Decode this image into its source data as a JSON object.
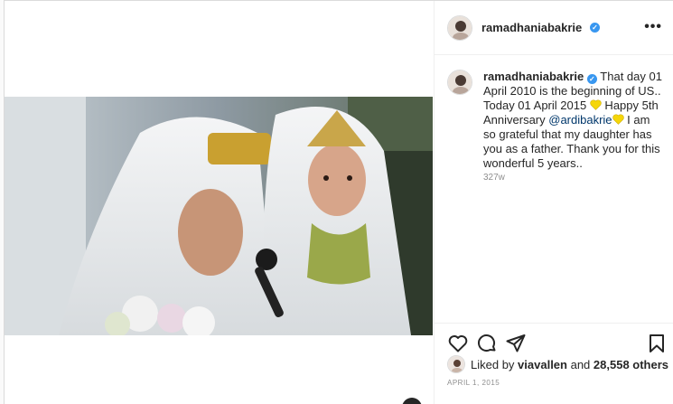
{
  "post": {
    "username": "ramadhaniabakrie",
    "verified": true,
    "more_icon": "more-horizontal-icon"
  },
  "caption": {
    "username": "ramadhaniabakrie",
    "text_before_mention": "That day 01 April 2010 is the beginning of US.. Today 01 April 2015 ",
    "heart_1": "yellow-heart-icon",
    "text_between": " Happy 5th Anniversary ",
    "mention": "@ardibakrie",
    "heart_2": "yellow-heart-icon",
    "text_after": " I am so grateful that my daughter has you as a father. Thank you for this wonderful 5 years..",
    "age": "327w"
  },
  "actions": {
    "like_icon": "heart-outline-icon",
    "comment_icon": "comment-icon",
    "share_icon": "paper-plane-icon",
    "save_icon": "bookmark-icon"
  },
  "likes": {
    "prefix": "Liked by ",
    "first_liker": "viavallen",
    "and": " and ",
    "others": "28,558 others"
  },
  "date": "APRIL 1, 2015",
  "colors": {
    "accent_blue": "#3897f0",
    "heart_yellow": "#f5d60a",
    "mention_blue": "#00376b",
    "muted": "#8e8e8e"
  }
}
